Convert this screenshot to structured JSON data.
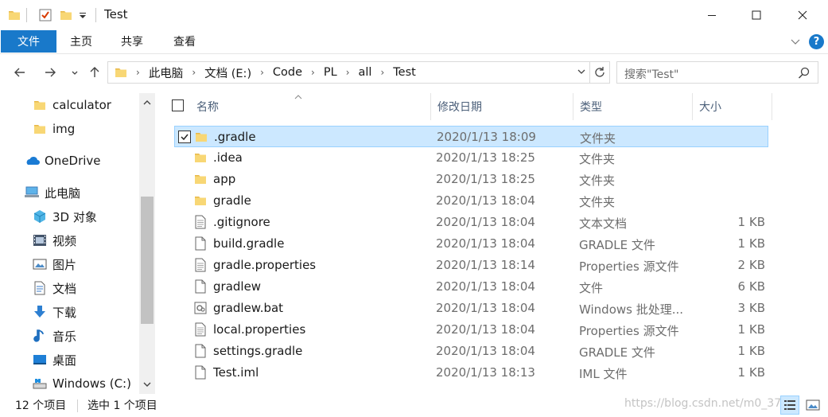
{
  "window": {
    "title": "Test"
  },
  "ribbon": {
    "tabs": [
      "文件",
      "主页",
      "共享",
      "查看"
    ]
  },
  "address": {
    "crumbs": [
      "此电脑",
      "文档 (E:)",
      "Code",
      "PL",
      "all",
      "Test"
    ]
  },
  "search": {
    "placeholder": "搜索\"Test\""
  },
  "nav": {
    "items": [
      {
        "label": "calculator",
        "icon": "folder-icon"
      },
      {
        "label": "img",
        "icon": "folder-icon"
      },
      {
        "label": "OneDrive",
        "icon": "onedrive-icon"
      },
      {
        "label": "此电脑",
        "icon": "this-pc-icon"
      },
      {
        "label": "3D 对象",
        "icon": "3d-objects-icon"
      },
      {
        "label": "视频",
        "icon": "videos-icon"
      },
      {
        "label": "图片",
        "icon": "pictures-icon"
      },
      {
        "label": "文档",
        "icon": "documents-icon"
      },
      {
        "label": "下载",
        "icon": "downloads-icon"
      },
      {
        "label": "音乐",
        "icon": "music-icon"
      },
      {
        "label": "桌面",
        "icon": "desktop-icon"
      },
      {
        "label": "Windows (C:)",
        "icon": "drive-icon"
      }
    ]
  },
  "columns": {
    "name": "名称",
    "date": "修改日期",
    "type": "类型",
    "size": "大小"
  },
  "files": [
    {
      "name": ".gradle",
      "date": "2020/1/13 18:09",
      "type": "文件夹",
      "size": "",
      "icon": "folder-icon",
      "selected": true
    },
    {
      "name": ".idea",
      "date": "2020/1/13 18:25",
      "type": "文件夹",
      "size": "",
      "icon": "folder-icon",
      "selected": false
    },
    {
      "name": "app",
      "date": "2020/1/13 18:25",
      "type": "文件夹",
      "size": "",
      "icon": "folder-icon",
      "selected": false
    },
    {
      "name": "gradle",
      "date": "2020/1/13 18:04",
      "type": "文件夹",
      "size": "",
      "icon": "folder-icon",
      "selected": false
    },
    {
      "name": ".gitignore",
      "date": "2020/1/13 18:04",
      "type": "文本文档",
      "size": "1 KB",
      "icon": "text-file-icon",
      "selected": false
    },
    {
      "name": "build.gradle",
      "date": "2020/1/13 18:04",
      "type": "GRADLE 文件",
      "size": "1 KB",
      "icon": "file-icon",
      "selected": false
    },
    {
      "name": "gradle.properties",
      "date": "2020/1/13 18:14",
      "type": "Properties 源文件",
      "size": "2 KB",
      "icon": "text-file-icon",
      "selected": false
    },
    {
      "name": "gradlew",
      "date": "2020/1/13 18:04",
      "type": "文件",
      "size": "6 KB",
      "icon": "file-icon",
      "selected": false
    },
    {
      "name": "gradlew.bat",
      "date": "2020/1/13 18:04",
      "type": "Windows 批处理...",
      "size": "3 KB",
      "icon": "batch-file-icon",
      "selected": false
    },
    {
      "name": "local.properties",
      "date": "2020/1/13 18:04",
      "type": "Properties 源文件",
      "size": "1 KB",
      "icon": "text-file-icon",
      "selected": false
    },
    {
      "name": "settings.gradle",
      "date": "2020/1/13 18:04",
      "type": "GRADLE 文件",
      "size": "1 KB",
      "icon": "file-icon",
      "selected": false
    },
    {
      "name": "Test.iml",
      "date": "2020/1/13 18:13",
      "type": "IML 文件",
      "size": "1 KB",
      "icon": "file-icon",
      "selected": false
    }
  ],
  "status": {
    "count": "12 个项目",
    "selection": "选中 1 个项目",
    "watermark": "https://blog.csdn.net/m0_37"
  },
  "colors": {
    "accent": "#1979ca",
    "selection_bg": "#cce8ff",
    "selection_border": "#99d1ff",
    "folder": "#f8d775"
  }
}
